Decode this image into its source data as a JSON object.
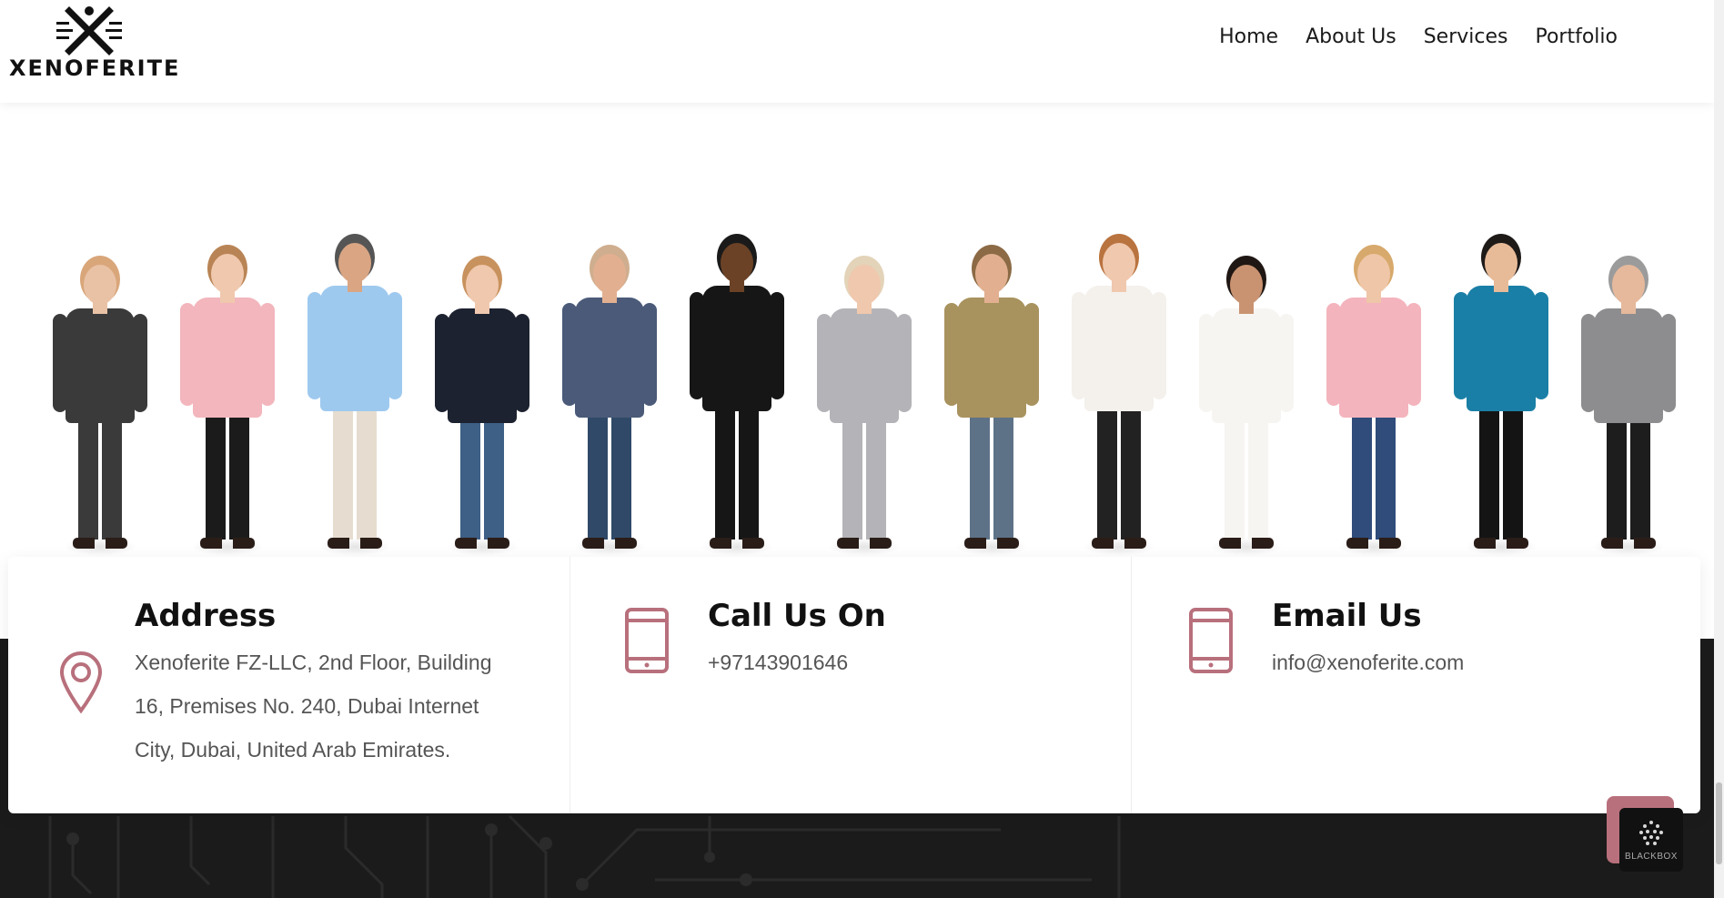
{
  "brand": {
    "name": "XENOFERITE"
  },
  "nav": {
    "items": [
      "Home",
      "About Us",
      "Services",
      "Portfolio"
    ]
  },
  "contact": {
    "address": {
      "title": "Address",
      "lines": [
        "Xenoferite FZ-LLC, 2nd Floor, Building",
        "16, Premises No. 240, Dubai Internet",
        "City, Dubai, United Arab Emirates."
      ],
      "icon": "location-pin-icon"
    },
    "phone": {
      "title": "Call Us On",
      "value": "+97143901646",
      "icon": "tablet-icon"
    },
    "email": {
      "title": "Email Us",
      "value": "info@xenoferite.com",
      "icon": "tablet-icon"
    }
  },
  "widgets": {
    "blackbox_label": "BLACKBOX"
  },
  "colors": {
    "accent": "#b8707c",
    "dark": "#1c1b1b",
    "text": "#111111"
  },
  "people": [
    {
      "skin": "#e9c2a6",
      "hair": "#d9a67a",
      "top": "#3a3a3a",
      "bottom": "#3a3a3a"
    },
    {
      "skin": "#f0c8ae",
      "hair": "#b98455",
      "top": "#f2b6bc",
      "bottom": "#1b1b1b"
    },
    {
      "skin": "#d9a583",
      "hair": "#555555",
      "top": "#9ec9ef",
      "bottom": "#e6ddd0"
    },
    {
      "skin": "#f0c8ae",
      "hair": "#c8925e",
      "top": "#1d2230",
      "bottom": "#3e5f86"
    },
    {
      "skin": "#e2b090",
      "hair": "#cfae8f",
      "top": "#4a5a78",
      "bottom": "#304968"
    },
    {
      "skin": "#6b4226",
      "hair": "#1a1a1a",
      "top": "#161616",
      "bottom": "#161616"
    },
    {
      "skin": "#f0c8ae",
      "hair": "#e3d3b8",
      "top": "#b4b4b8",
      "bottom": "#b4b4b8"
    },
    {
      "skin": "#e2b090",
      "hair": "#8b6a45",
      "top": "#a8925e",
      "bottom": "#5d7287"
    },
    {
      "skin": "#f0c8ae",
      "hair": "#b9733f",
      "top": "#f4f1ec",
      "bottom": "#222222"
    },
    {
      "skin": "#c99372",
      "hair": "#1f1713",
      "top": "#f7f5f2",
      "bottom": "#f7f5f2"
    },
    {
      "skin": "#efc6a8",
      "hair": "#d7a96c",
      "top": "#f4b4bd",
      "bottom": "#2f4c7a"
    },
    {
      "skin": "#e8bb98",
      "hair": "#1e1a18",
      "top": "#1a7fa6",
      "bottom": "#141414"
    },
    {
      "skin": "#e6b99c",
      "hair": "#9b9b9b",
      "top": "#8d8d8f",
      "bottom": "#1d1d1d"
    }
  ]
}
